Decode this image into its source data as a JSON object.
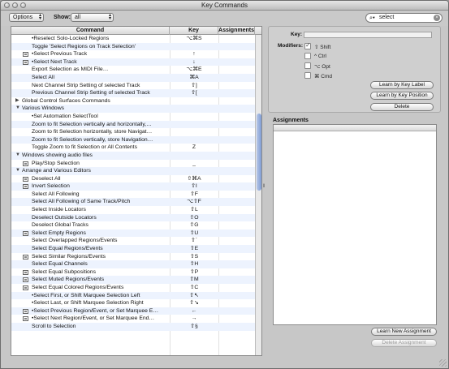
{
  "window": {
    "title": "Key Commands"
  },
  "toolbar": {
    "options_label": "Options",
    "show_label": "Show:",
    "show_value": "all",
    "search_value": "select"
  },
  "table": {
    "columns": [
      "Command",
      "Key",
      "Assignments"
    ],
    "rows": [
      {
        "cmd": "•Reselect Solo-Locked Regions",
        "key": "⌥⌘S",
        "lvl": 2,
        "disc": "",
        "icon": false
      },
      {
        "cmd": "Toggle 'Select Regions on Track Selection'",
        "key": "",
        "lvl": 2,
        "disc": "",
        "icon": false
      },
      {
        "cmd": "•Select Previous Track",
        "key": "↑",
        "lvl": 2,
        "disc": "",
        "icon": true
      },
      {
        "cmd": "•Select Next Track",
        "key": "↓",
        "lvl": 2,
        "disc": "",
        "icon": true
      },
      {
        "cmd": "Export Selection as MIDI File…",
        "key": "⌥⌘E",
        "lvl": 2,
        "disc": "",
        "icon": false
      },
      {
        "cmd": "Select All",
        "key": "⌘A",
        "lvl": 2,
        "disc": "",
        "icon": false
      },
      {
        "cmd": "Next Channel Strip Setting of selected Track",
        "key": "⇧]",
        "lvl": 2,
        "disc": "",
        "icon": false
      },
      {
        "cmd": "Previous Channel Strip Setting of selected Track",
        "key": "⇧[",
        "lvl": 2,
        "disc": "",
        "icon": false
      },
      {
        "cmd": "Global Control Surfaces Commands",
        "key": "",
        "lvl": 1,
        "disc": "▶",
        "icon": false
      },
      {
        "cmd": "Various Windows",
        "key": "",
        "lvl": 1,
        "disc": "▼",
        "icon": false
      },
      {
        "cmd": "•Set Automation SelectTool",
        "key": "",
        "lvl": 2,
        "disc": "",
        "icon": false
      },
      {
        "cmd": "Zoom to fit Selection vertically and horizontally,…",
        "key": "",
        "lvl": 2,
        "disc": "",
        "icon": false
      },
      {
        "cmd": "Zoom to fit Selection horizontally, store Navigat…",
        "key": "",
        "lvl": 2,
        "disc": "",
        "icon": false
      },
      {
        "cmd": "Zoom to fit Selection vertically, store Navigation…",
        "key": "",
        "lvl": 2,
        "disc": "",
        "icon": false
      },
      {
        "cmd": "Toggle Zoom to fit Selection or All Contents",
        "key": "Z",
        "lvl": 2,
        "disc": "",
        "icon": false
      },
      {
        "cmd": "Windows showing audio files",
        "key": "",
        "lvl": 1,
        "disc": "▼",
        "icon": false
      },
      {
        "cmd": "Play/Stop Selection",
        "key": "_",
        "lvl": 2,
        "disc": "",
        "icon": true
      },
      {
        "cmd": "Arrange and Various Editors",
        "key": "",
        "lvl": 1,
        "disc": "▼",
        "icon": false
      },
      {
        "cmd": "Deselect All",
        "key": "⇧⌘A",
        "lvl": 2,
        "disc": "",
        "icon": true
      },
      {
        "cmd": "Invert Selection",
        "key": "⇧I",
        "lvl": 2,
        "disc": "",
        "icon": true
      },
      {
        "cmd": "Select All Following",
        "key": "⇧F",
        "lvl": 2,
        "disc": "",
        "icon": false
      },
      {
        "cmd": "Select All Following of Same Track/Pitch",
        "key": "⌥⇧F",
        "lvl": 2,
        "disc": "",
        "icon": false
      },
      {
        "cmd": "Select Inside Locators",
        "key": "⇧L",
        "lvl": 2,
        "disc": "",
        "icon": false
      },
      {
        "cmd": "Deselect Outside Locators",
        "key": "⇧O",
        "lvl": 2,
        "disc": "",
        "icon": false
      },
      {
        "cmd": "Deselect Global Tracks",
        "key": "⇧G",
        "lvl": 2,
        "disc": "",
        "icon": false
      },
      {
        "cmd": "Select Empty Regions",
        "key": "⇧U",
        "lvl": 2,
        "disc": "",
        "icon": true
      },
      {
        "cmd": "Select Overlapped Regions/Events",
        "key": "⇧`",
        "lvl": 2,
        "disc": "",
        "icon": false
      },
      {
        "cmd": "Select Equal Regions/Events",
        "key": "⇧E",
        "lvl": 2,
        "disc": "",
        "icon": false
      },
      {
        "cmd": "Select Similar Regions/Events",
        "key": "⇧S",
        "lvl": 2,
        "disc": "",
        "icon": true
      },
      {
        "cmd": "Select Equal Channels",
        "key": "⇧H",
        "lvl": 2,
        "disc": "",
        "icon": false
      },
      {
        "cmd": "Select Equal Subpositions",
        "key": "⇧P",
        "lvl": 2,
        "disc": "",
        "icon": true
      },
      {
        "cmd": "Select Muted Regions/Events",
        "key": "⇧M",
        "lvl": 2,
        "disc": "",
        "icon": true
      },
      {
        "cmd": "Select Equal Colored Regions/Events",
        "key": "⇧C",
        "lvl": 2,
        "disc": "",
        "icon": true
      },
      {
        "cmd": "•Select First, or Shift Marquee Selection Left",
        "key": "⇧↖",
        "lvl": 2,
        "disc": "",
        "icon": false
      },
      {
        "cmd": "•Select Last, or Shift Marquee Selection Right",
        "key": "⇧↘",
        "lvl": 2,
        "disc": "",
        "icon": false
      },
      {
        "cmd": "•Select Previous Region/Event, or Set Marquee E…",
        "key": "←",
        "lvl": 2,
        "disc": "",
        "icon": true
      },
      {
        "cmd": "•Select Next Region/Event, or Set Marquee End…",
        "key": "→",
        "lvl": 2,
        "disc": "",
        "icon": true
      },
      {
        "cmd": "Scroll to Selection",
        "key": "⇧§",
        "lvl": 2,
        "disc": "",
        "icon": false
      }
    ]
  },
  "keypanel": {
    "key_label": "Key:",
    "key_value": "",
    "modifiers_label": "Modifiers:",
    "modifiers": [
      {
        "label": "⇧ Shift",
        "checked": true
      },
      {
        "label": "^ Ctrl",
        "checked": false
      },
      {
        "label": "⌥ Opt",
        "checked": false
      },
      {
        "label": "⌘ Cmd",
        "checked": false
      }
    ],
    "learn_label_btn": "Learn by Key Label",
    "learn_position_btn": "Learn by Key Position",
    "delete_btn": "Delete"
  },
  "assignments": {
    "title": "Assignments",
    "learn_new_btn": "Learn New Assignment",
    "delete_assignment_btn": "Delete Assignment"
  }
}
